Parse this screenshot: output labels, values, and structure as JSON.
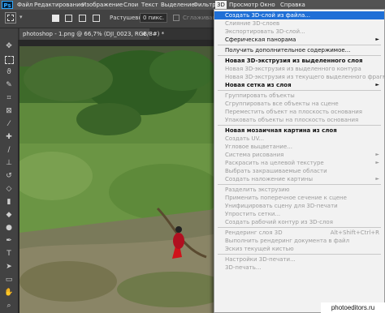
{
  "menubar": {
    "logo": "Ps",
    "items": [
      "Файл",
      "Редактирование",
      "Изображение",
      "Слои",
      "Текст",
      "Выделение",
      "Фильтр",
      "3D",
      "Просмотр",
      "Окно",
      "Справка"
    ]
  },
  "options": {
    "feather_label": "Растушевка:",
    "feather_value": "0 пикс.",
    "antialias_label": "Сглаживание"
  },
  "document_tab": {
    "title": "photoshop - 1.png @ 66,7% (DJI_0023, RGB/8#) *",
    "close": "×"
  },
  "menu_3d": {
    "items": [
      {
        "label": "Создать 3D-слой из файла...",
        "state": "highlighted"
      },
      {
        "label": "Слияние 3D-слоев",
        "state": "disabled"
      },
      {
        "label": "Экспортировать 3D-слой...",
        "state": "disabled"
      },
      {
        "label": "Сферическая панорама",
        "state": "submenu"
      },
      {
        "sep": true
      },
      {
        "label": "Получить дополнительное содержимое...",
        "state": "enabled"
      },
      {
        "sep": true
      },
      {
        "label": "Новая 3D-экструзия из выделенного слоя",
        "state": "bold"
      },
      {
        "label": "Новая 3D-экструзия из выделенного контура",
        "state": "disabled"
      },
      {
        "label": "Новая 3D-экструзия из текущего выделенного фрагмента",
        "state": "disabled"
      },
      {
        "label": "Новая сетка из слоя",
        "state": "submenu-bold"
      },
      {
        "sep": true
      },
      {
        "label": "Группировать объекты",
        "state": "disabled"
      },
      {
        "label": "Сгруппировать все объекты на сцене",
        "state": "disabled"
      },
      {
        "label": "Переместить объект на плоскость основания",
        "state": "disabled"
      },
      {
        "label": "Упаковать объекты на плоскость основания",
        "state": "disabled"
      },
      {
        "sep": true
      },
      {
        "label": "Новая мозаичная картина из слоя",
        "state": "bold"
      },
      {
        "label": "Создать UV...",
        "state": "disabled"
      },
      {
        "label": "Угловое выцветание...",
        "state": "disabled"
      },
      {
        "label": "Система рисования",
        "state": "disabled-submenu"
      },
      {
        "label": "Раскрасить на целевой текстуре",
        "state": "disabled-submenu"
      },
      {
        "label": "Выбрать закрашиваемые области",
        "state": "disabled"
      },
      {
        "label": "Создать наложение картины",
        "state": "disabled-submenu"
      },
      {
        "sep": true
      },
      {
        "label": "Разделить экструзию",
        "state": "disabled"
      },
      {
        "label": "Применить поперечное сечение к сцене",
        "state": "disabled"
      },
      {
        "label": "Унифицировать сцену для 3D-печати",
        "state": "disabled"
      },
      {
        "label": "Упростить сетки...",
        "state": "disabled"
      },
      {
        "label": "Создать рабочий контур из 3D-слоя",
        "state": "disabled"
      },
      {
        "sep": true
      },
      {
        "label": "Рендеринг слоя 3D",
        "state": "disabled",
        "shortcut": "Alt+Shift+Ctrl+R"
      },
      {
        "label": "Выполнить рендеринг документа в файл",
        "state": "disabled"
      },
      {
        "label": "Эскиз текущей кистью",
        "state": "disabled"
      },
      {
        "sep": true
      },
      {
        "label": "Настройки 3D-печати...",
        "state": "disabled"
      },
      {
        "label": "3D-печать...",
        "state": "disabled"
      }
    ]
  },
  "watermark": "photoeditors.ru",
  "colors": {
    "highlight": "#1f6fd6",
    "menu_bg": "#f2f2f2",
    "app_bg": "#282828"
  }
}
